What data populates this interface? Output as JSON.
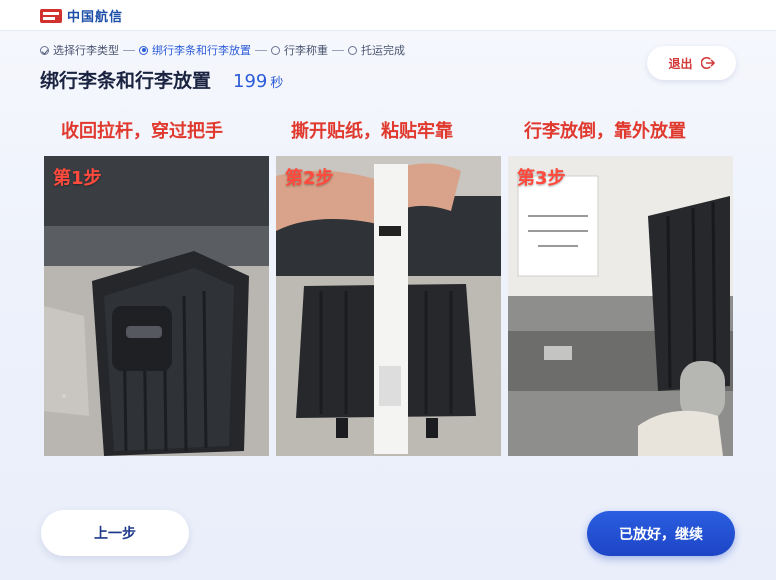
{
  "header": {
    "logo_text": "中国航信",
    "logo_icon": "travelsky-logo-icon"
  },
  "steps": [
    {
      "label": "选择行李类型",
      "state": "done"
    },
    {
      "label": "绑行李条和行李放置",
      "state": "active"
    },
    {
      "label": "行李称重",
      "state": "pending"
    },
    {
      "label": "托运完成",
      "state": "pending"
    }
  ],
  "page": {
    "title": "绑行李条和行李放置",
    "countdown": "199",
    "countdown_unit": "秒"
  },
  "exit": {
    "label": "退出",
    "icon": "logout-icon"
  },
  "instructions": [
    {
      "caption": "收回拉杆，穿过把手",
      "badge": "第1步"
    },
    {
      "caption": "撕开贴纸，粘贴牢靠",
      "badge": "第2步"
    },
    {
      "caption": "行李放倒，靠外放置",
      "badge": "第3步"
    }
  ],
  "buttons": {
    "prev": "上一步",
    "next": "已放好，继续"
  },
  "colors": {
    "accent": "#2b5bd7",
    "caption_red": "#e03a2f",
    "primary_button": "#1c45c6"
  }
}
